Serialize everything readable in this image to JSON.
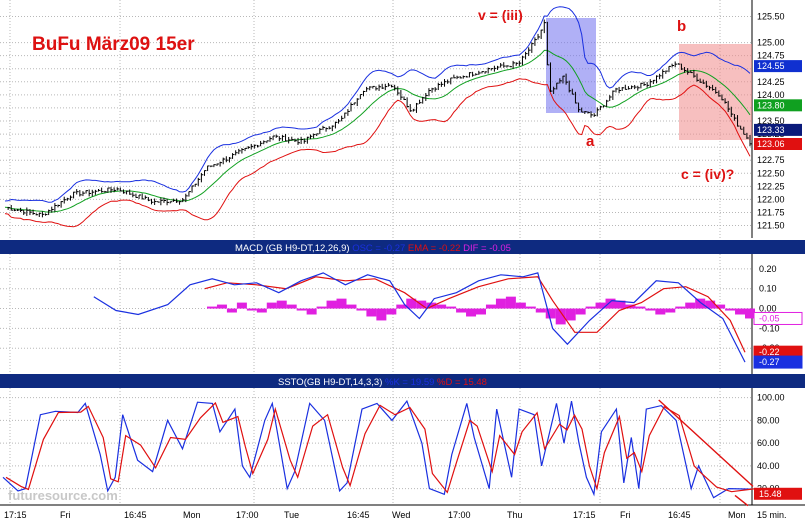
{
  "chart_data": [
    {
      "type": "candlestick",
      "title": "BuFu März09 15er",
      "ylim": [
        121.3,
        125.7
      ],
      "ticks": [
        "125.50",
        "125.00",
        "124.75",
        "124.50",
        "124.25",
        "124.00",
        "123.75",
        "123.50",
        "123.25",
        "123.00",
        "122.75",
        "122.50",
        "122.25",
        "122.00",
        "121.75",
        "121.50"
      ],
      "tags": [
        {
          "label": "124.55",
          "value": 124.55,
          "color": "#1030d0"
        },
        {
          "label": "123.80",
          "value": 123.8,
          "color": "#10a020"
        },
        {
          "label": "123.33",
          "value": 123.33,
          "color": "#0a1a7a"
        },
        {
          "label": "123.06",
          "value": 123.06,
          "color": "#e01010"
        }
      ],
      "annotations": [
        {
          "text": "v = (iii)",
          "size": 14
        },
        {
          "text": "b",
          "size": 15
        },
        {
          "text": "a",
          "size": 15
        },
        {
          "text": "c = (iv)?",
          "size": 14
        }
      ],
      "price_path": [
        [
          0,
          121.85
        ],
        [
          0.05,
          121.7
        ],
        [
          0.09,
          122.1
        ],
        [
          0.15,
          122.2
        ],
        [
          0.2,
          121.95
        ],
        [
          0.24,
          122.0
        ],
        [
          0.27,
          122.6
        ],
        [
          0.3,
          122.8
        ],
        [
          0.33,
          123.0
        ],
        [
          0.36,
          123.2
        ],
        [
          0.4,
          123.1
        ],
        [
          0.42,
          123.3
        ],
        [
          0.45,
          123.5
        ],
        [
          0.48,
          124.1
        ],
        [
          0.52,
          124.2
        ],
        [
          0.545,
          123.7
        ],
        [
          0.57,
          124.1
        ],
        [
          0.6,
          124.3
        ],
        [
          0.65,
          124.5
        ],
        [
          0.69,
          124.6
        ],
        [
          0.715,
          125.1
        ],
        [
          0.725,
          125.4
        ],
        [
          0.73,
          124.0
        ],
        [
          0.75,
          124.35
        ],
        [
          0.77,
          123.7
        ],
        [
          0.79,
          123.6
        ],
        [
          0.82,
          124.1
        ],
        [
          0.86,
          124.2
        ],
        [
          0.89,
          124.5
        ],
        [
          0.9,
          124.6
        ],
        [
          0.93,
          124.3
        ],
        [
          0.96,
          124.0
        ],
        [
          0.98,
          123.5
        ],
        [
          1.0,
          123.1
        ]
      ]
    },
    {
      "type": "line",
      "title": "MACD (GB H9-DT,12,26,9)",
      "legend": [
        {
          "text": "OSC = -0.27",
          "color": "#1a30e0"
        },
        {
          "text": "EMA = -0.22",
          "color": "#e01010"
        },
        {
          "text": "DIF = -0.05",
          "color": "#e020e0"
        }
      ],
      "ylim": [
        -0.32,
        0.26
      ],
      "ticks": [
        "0.20",
        "0.10",
        "0.00",
        "-0.10",
        "-0.20"
      ],
      "tags": [
        {
          "label": "-0.05",
          "value": -0.05,
          "color": "#e020e0"
        },
        {
          "label": "-0.22",
          "value": -0.22,
          "color": "#e01010"
        },
        {
          "label": "-0.27",
          "value": -0.27,
          "color": "#1a30e0"
        }
      ],
      "osc_path": [
        [
          0.12,
          0.06
        ],
        [
          0.15,
          -0.01
        ],
        [
          0.18,
          -0.03
        ],
        [
          0.22,
          0.02
        ],
        [
          0.25,
          0.12
        ],
        [
          0.28,
          0.15
        ],
        [
          0.31,
          0.12
        ],
        [
          0.34,
          0.13
        ],
        [
          0.37,
          0.08
        ],
        [
          0.4,
          0.14
        ],
        [
          0.43,
          0.18
        ],
        [
          0.46,
          0.12
        ],
        [
          0.49,
          0.17
        ],
        [
          0.52,
          0.14
        ],
        [
          0.54,
          0.02
        ],
        [
          0.56,
          -0.05
        ],
        [
          0.58,
          0.05
        ],
        [
          0.61,
          0.08
        ],
        [
          0.64,
          0.14
        ],
        [
          0.67,
          0.17
        ],
        [
          0.7,
          0.16
        ],
        [
          0.72,
          0.18
        ],
        [
          0.74,
          -0.1
        ],
        [
          0.76,
          -0.18
        ],
        [
          0.79,
          -0.06
        ],
        [
          0.82,
          0.04
        ],
        [
          0.85,
          0.03
        ],
        [
          0.88,
          0.14
        ],
        [
          0.91,
          0.13
        ],
        [
          0.94,
          0.03
        ],
        [
          0.97,
          -0.05
        ],
        [
          1.0,
          -0.27
        ]
      ],
      "ema_path": [
        [
          0.27,
          0.1
        ],
        [
          0.3,
          0.13
        ],
        [
          0.34,
          0.12
        ],
        [
          0.38,
          0.1
        ],
        [
          0.42,
          0.16
        ],
        [
          0.46,
          0.14
        ],
        [
          0.5,
          0.15
        ],
        [
          0.54,
          0.08
        ],
        [
          0.57,
          0.0
        ],
        [
          0.6,
          0.05
        ],
        [
          0.64,
          0.11
        ],
        [
          0.68,
          0.15
        ],
        [
          0.72,
          0.16
        ],
        [
          0.74,
          0.04
        ],
        [
          0.77,
          -0.12
        ],
        [
          0.8,
          -0.12
        ],
        [
          0.83,
          -0.01
        ],
        [
          0.86,
          0.03
        ],
        [
          0.89,
          0.1
        ],
        [
          0.92,
          0.11
        ],
        [
          0.95,
          0.06
        ],
        [
          0.98,
          -0.06
        ],
        [
          1.0,
          -0.22
        ]
      ],
      "dif_bars": [
        0.01,
        0.02,
        -0.02,
        0.03,
        -0.01,
        -0.02,
        0.03,
        0.04,
        0.02,
        -0.01,
        -0.03,
        0.01,
        0.04,
        0.05,
        0.02,
        -0.01,
        -0.04,
        -0.06,
        -0.03,
        0.02,
        0.05,
        0.04,
        0.03,
        0.02,
        0.01,
        -0.02,
        -0.04,
        -0.03,
        0.02,
        0.05,
        0.06,
        0.03,
        0.01,
        -0.02,
        -0.05,
        -0.08,
        -0.06,
        -0.03,
        0.01,
        0.03,
        0.05,
        0.04,
        0.02,
        0.01,
        -0.01,
        -0.03,
        -0.02,
        0.01,
        0.03,
        0.05,
        0.04,
        0.02,
        -0.01,
        -0.03,
        -0.05
      ]
    },
    {
      "type": "line",
      "title": "SSTO(GB H9-DT,14,3,3)",
      "legend": [
        {
          "text": "%K = 19.59",
          "color": "#1a30e0"
        },
        {
          "text": "%D = 15.48",
          "color": "#e01010"
        }
      ],
      "ylim": [
        10,
        105
      ],
      "ticks": [
        "100.00",
        "80.00",
        "60.00",
        "40.00",
        "20.00"
      ],
      "tags": [
        {
          "label": "15.48",
          "value": 15.48,
          "color": "#e01010"
        }
      ],
      "k_path": [
        [
          0,
          30
        ],
        [
          0.02,
          18
        ],
        [
          0.03,
          20
        ],
        [
          0.05,
          85
        ],
        [
          0.07,
          88
        ],
        [
          0.1,
          87
        ],
        [
          0.11,
          95
        ],
        [
          0.13,
          50
        ],
        [
          0.14,
          18
        ],
        [
          0.15,
          30
        ],
        [
          0.16,
          85
        ],
        [
          0.18,
          45
        ],
        [
          0.2,
          35
        ],
        [
          0.22,
          80
        ],
        [
          0.24,
          55
        ],
        [
          0.26,
          96
        ],
        [
          0.28,
          95
        ],
        [
          0.29,
          70
        ],
        [
          0.31,
          90
        ],
        [
          0.32,
          40
        ],
        [
          0.33,
          30
        ],
        [
          0.35,
          80
        ],
        [
          0.36,
          95
        ],
        [
          0.38,
          20
        ],
        [
          0.39,
          35
        ],
        [
          0.41,
          95
        ],
        [
          0.43,
          80
        ],
        [
          0.45,
          18
        ],
        [
          0.46,
          25
        ],
        [
          0.48,
          90
        ],
        [
          0.5,
          95
        ],
        [
          0.52,
          80
        ],
        [
          0.54,
          97
        ],
        [
          0.56,
          60
        ],
        [
          0.57,
          20
        ],
        [
          0.59,
          15
        ],
        [
          0.6,
          50
        ],
        [
          0.62,
          95
        ],
        [
          0.63,
          65
        ],
        [
          0.65,
          20
        ],
        [
          0.66,
          90
        ],
        [
          0.68,
          30
        ],
        [
          0.69,
          90
        ],
        [
          0.71,
          85
        ],
        [
          0.72,
          40
        ],
        [
          0.74,
          95
        ],
        [
          0.75,
          60
        ],
        [
          0.76,
          97
        ],
        [
          0.77,
          60
        ],
        [
          0.78,
          30
        ],
        [
          0.79,
          15
        ],
        [
          0.8,
          70
        ],
        [
          0.82,
          90
        ],
        [
          0.83,
          25
        ],
        [
          0.84,
          65
        ],
        [
          0.85,
          20
        ],
        [
          0.86,
          90
        ],
        [
          0.88,
          93
        ],
        [
          0.9,
          80
        ],
        [
          0.92,
          20
        ],
        [
          0.93,
          40
        ],
        [
          0.95,
          12
        ],
        [
          0.97,
          20
        ],
        [
          1.0,
          19.59
        ]
      ],
      "trend": [
        [
          0.89,
          98
        ],
        [
          1.0,
          22
        ]
      ]
    }
  ],
  "time_axis": [
    "17:15",
    "Fri",
    "16:45",
    "Mon",
    "17:00",
    "Tue",
    "16:45",
    "Wed",
    "17:00",
    "Thu",
    "17:15",
    "Fri",
    "16:45",
    "Mon",
    "15 min."
  ],
  "watermark": "futuresource.com"
}
